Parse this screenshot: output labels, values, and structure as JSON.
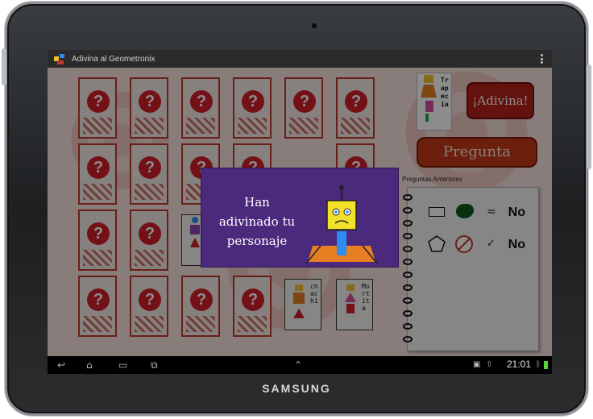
{
  "device": {
    "brand": "SAMSUNG"
  },
  "app": {
    "title": "Adivina al Geometronix"
  },
  "board": {
    "mystery_cards": 18,
    "characters": [
      {
        "name": "chachi"
      },
      {
        "name": "Mortita"
      }
    ]
  },
  "panel": {
    "my_character": "Trapecia",
    "guess_button": "¡Adivina!",
    "ask_button": "Pregunta",
    "previous_label": "Preguntas Anteriores",
    "previous_questions": [
      {
        "shape": "rectangle-icon",
        "color": "green-blob-icon",
        "relation": "approx-check-icon",
        "answer": "No"
      },
      {
        "shape": "pentagon-icon",
        "color": "no-color-icon",
        "relation": "check-icon",
        "answer": "No"
      }
    ]
  },
  "dialog": {
    "message": "Han adivinado tu personaje"
  },
  "status": {
    "time": "21:01"
  },
  "colors": {
    "accent": "#b4211a",
    "dialog": "#4b2a7e",
    "card_border": "#c0392b"
  }
}
